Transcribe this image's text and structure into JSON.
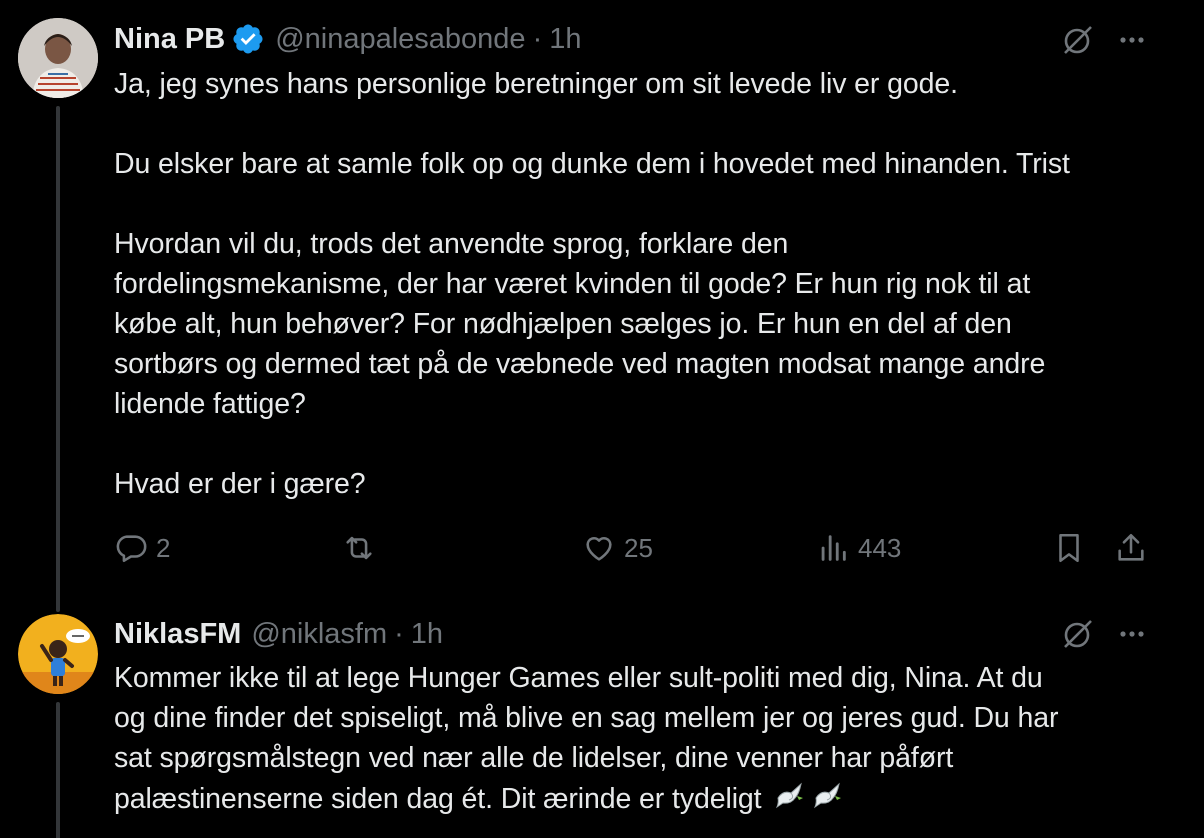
{
  "tweets": [
    {
      "name": "Nina PB",
      "handle": "@ninapalesabonde",
      "separator": "·",
      "time": "1h",
      "verified": true,
      "paragraphs": [
        [
          "Ja, jeg synes hans personlige beretninger om sit levede liv er gode."
        ],
        [
          "Du elsker bare at samle folk op og dunke dem i hovedet med hinanden. Trist"
        ],
        [
          "Hvordan vil du, trods det anvendte sprog, forklare den",
          "fordelingsmekanisme, der har været kvinden til gode? Er hun rig nok til at",
          "købe alt, hun behøver? For nødhjælpen sælges jo. Er hun en del af den",
          "sortbørs og dermed tæt på de væbnede ved magten modsat mange andre",
          "lidende fattige?"
        ],
        [
          "Hvad er der i gære?"
        ]
      ],
      "actions": {
        "replies": "2",
        "retweets": "",
        "likes": "25",
        "views": "443"
      }
    },
    {
      "name": "NiklasFM",
      "handle": "@niklasfm",
      "separator": "·",
      "time": "1h",
      "verified": false,
      "lines": [
        "Kommer ikke til at lege Hunger Games eller sult-politi med dig, Nina. At du",
        "og dine finder det spiseligt, må blive en sag mellem jer og jeres gud. Du har",
        "sat spørgsmålstegn ved nær alle de lidelser, dine venner har påført",
        "palæstinenserne siden dag ét. Dit ærinde er tydeligt"
      ],
      "trailing_emoji": [
        "dove-icon",
        "dove-icon"
      ]
    }
  ],
  "colors": {
    "background": "#000000",
    "text": "#e7e9ea",
    "muted": "#71767b",
    "verified": "#1d9bf0",
    "thread_line": "#333639"
  }
}
